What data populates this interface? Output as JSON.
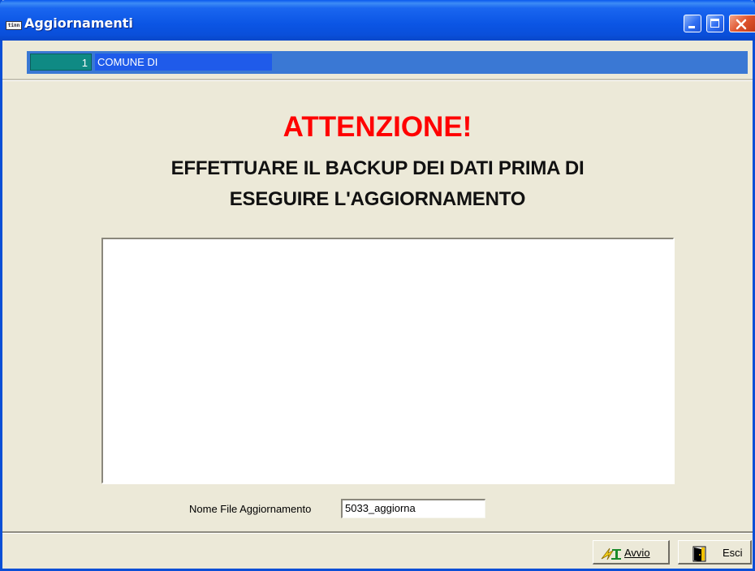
{
  "window": {
    "title": "Aggiornamenti",
    "icon": "tinn-app-icon",
    "icon_text": "tinn",
    "controls": [
      "minimize-icon",
      "maximize-icon",
      "close-icon"
    ]
  },
  "record_bar": {
    "number": "1",
    "name": "COMUNE DI"
  },
  "warning": {
    "title": "ATTENZIONE!",
    "line1": "EFFETTUARE IL BACKUP DEI DATI PRIMA DI",
    "line2": "ESEGUIRE L'AGGIORNAMENTO"
  },
  "log": {
    "content": ""
  },
  "file_field": {
    "label": "Nome File Aggiornamento",
    "value": "5033_aggiorna"
  },
  "buttons": {
    "start": "Avvio",
    "exit": "Esci"
  },
  "colors": {
    "warning_title": "#ff0000",
    "titlebar": "#0a4fda",
    "record_number_bg": "#0f8a84",
    "record_name_bg": "#1f5bea"
  }
}
